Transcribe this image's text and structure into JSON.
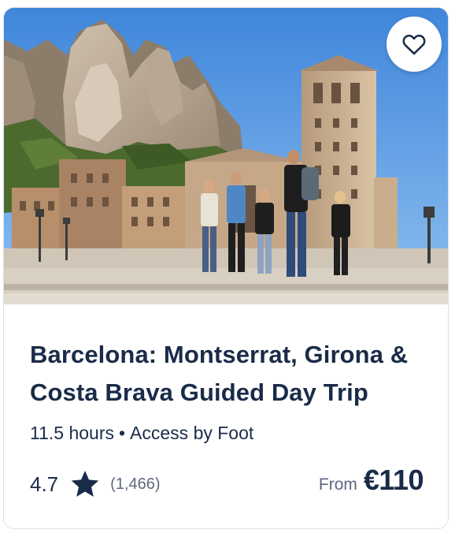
{
  "card": {
    "image_alt": "Group of tourists with a guide in front of Montserrat monastery and mountains",
    "wishlist_icon": "heart-outline-icon",
    "title": "Barcelona: Montserrat, Girona & Costa Brava Guided Day Trip",
    "duration": "11.5 hours",
    "separator": "•",
    "feature": "Access by Foot",
    "rating": "4.7",
    "rating_icon": "star-icon",
    "review_count": "(1,466)",
    "price_prefix": "From",
    "price": "€110"
  },
  "colors": {
    "text_primary": "#1a2b49",
    "text_secondary": "#5b6780",
    "card_border": "#dfe1e6"
  }
}
